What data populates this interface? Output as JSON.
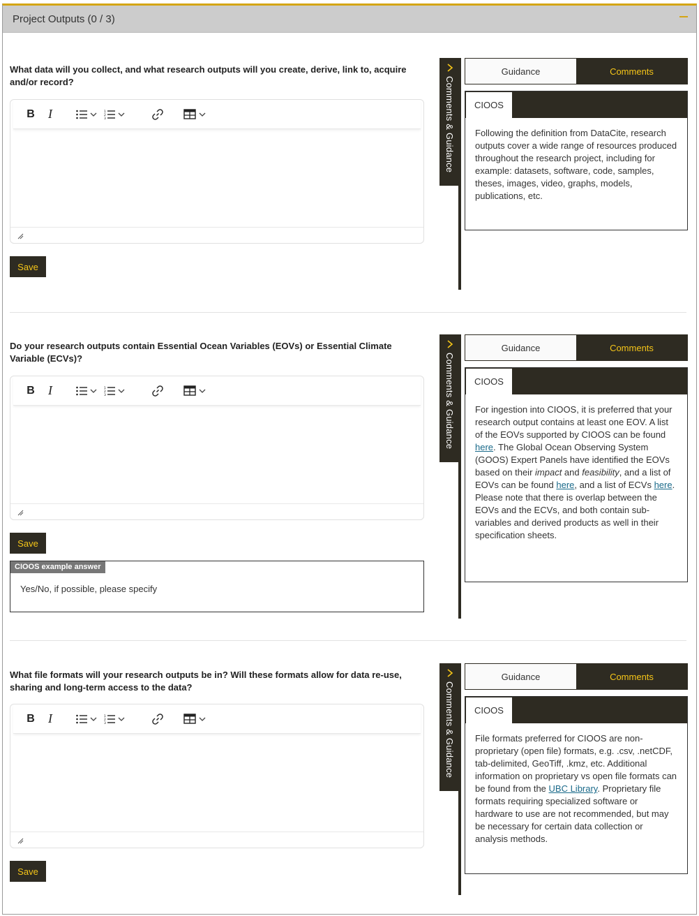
{
  "panel": {
    "title": "Project Outputs (0 / 3)"
  },
  "toolbar": {
    "bold": "B",
    "italic": "I"
  },
  "questions": [
    {
      "text": "What data will you collect, and what research outputs will you create, derive, link to, acquire and/or record?",
      "save_label": "Save",
      "side_tab_label": "Comments & Guidance",
      "tabs": {
        "guidance": "Guidance",
        "comments": "Comments"
      },
      "org_tab": "CIOOS",
      "guidance_text": "Following the definition from DataCite, research outputs cover a wide range of resources produced throughout the research project, including for example: datasets, software, code, samples, theses, images, video, graphs, models, publications, etc."
    },
    {
      "text": "Do your research outputs contain Essential Ocean Variables (EOVs) or Essential Climate Variable (ECVs)?",
      "save_label": "Save",
      "example_label": "CIOOS example answer",
      "example_text": "Yes/No, if possible, please specify",
      "side_tab_label": "Comments & Guidance",
      "tabs": {
        "guidance": "Guidance",
        "comments": "Comments"
      },
      "org_tab": "CIOOS",
      "guidance_parts": {
        "p1": "For ingestion into CIOOS, it is preferred that your research output contains at least one EOV. A list of the EOVs supported by CIOOS can be found ",
        "link1": "here",
        "p2": ". The Global Ocean Observing System (GOOS) Expert Panels have identified the EOVs based on their ",
        "em1": "impact",
        "p3": " and ",
        "em2": "feasibility",
        "p4": ", and a list of EOVs can be found ",
        "link2": "here",
        "p5": ", and a list of ECVs ",
        "link3": "here",
        "p6": ". Please note that there is overlap between the EOVs and the ECVs, and both contain sub-variables and derived products as well in their specification sheets."
      }
    },
    {
      "text": "What file formats will your research outputs be in? Will these formats allow for data re-use, sharing and long-term access to the data?",
      "save_label": "Save",
      "side_tab_label": "Comments & Guidance",
      "tabs": {
        "guidance": "Guidance",
        "comments": "Comments"
      },
      "org_tab": "CIOOS",
      "guidance_parts": {
        "p1": "File formats preferred for CIOOS are non-proprietary (open file) formats, e.g. .csv, .netCDF, tab-delimited, GeoTiff, .kmz, etc. Additional information on proprietary vs open file formats can be found from the ",
        "link1": "UBC Library",
        "p2": ". Proprietary file formats requiring specialized software or hardware to use are not recommended, but may be necessary for certain data collection or analysis methods."
      }
    }
  ],
  "colors": {
    "accent": "#f5c518",
    "dark": "#2e2b22",
    "header_bg": "#cccccc",
    "link": "#1a6a8a"
  },
  "icons": [
    "bold-icon",
    "italic-icon",
    "bullet-list-icon",
    "numbered-list-icon",
    "link-icon",
    "table-icon",
    "chevron-down-icon",
    "resize-handle-icon",
    "chevron-right-icon",
    "collapse-icon"
  ]
}
